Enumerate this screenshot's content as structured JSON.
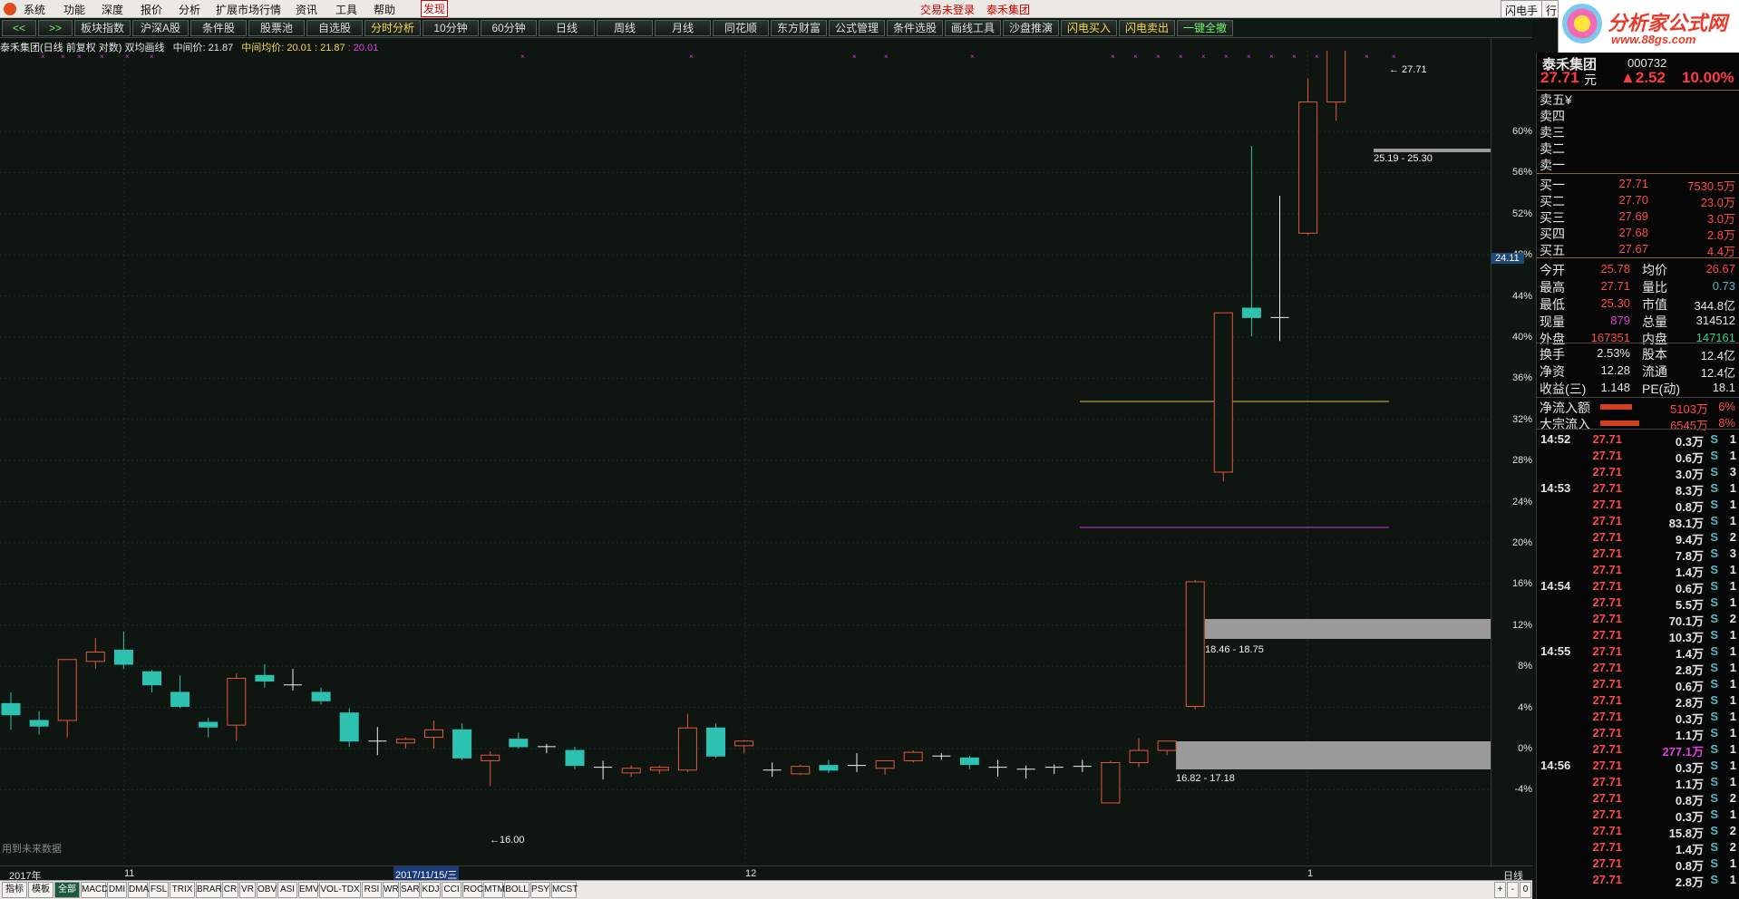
{
  "menubar": {
    "items": [
      "系统",
      "功能",
      "深度",
      "报价",
      "分析",
      "扩展市场行情",
      "资讯",
      "工具",
      "帮助"
    ],
    "discover": "发现",
    "login": "交易未登录",
    "stock_title": "泰禾集团",
    "shandian": "闪电手",
    "hang": "行"
  },
  "toolbar": {
    "prev": "<<",
    "next": ">>",
    "buttons": [
      "板块指数",
      "沪深A股",
      "条件股",
      "股票池",
      "自选股",
      "分时分析",
      "10分钟",
      "60分钟",
      "日线",
      "周线",
      "月线",
      "同花顺",
      "东方财富",
      "公式管理",
      "条件选股",
      "画线工具",
      "沙盘推演",
      "闪电买入",
      "闪电卖出",
      "一键全撤"
    ]
  },
  "brand": {
    "title": "分析家公式网",
    "url": "www.88gs.com"
  },
  "chart_header": {
    "title": "泰禾集团(日线 前复权 对数) 双均画线",
    "mid_label": "中间价: 21.87",
    "avg_label": "中间均价: 20.01 : 21.87",
    "avg_mag": ": 20.01"
  },
  "chart_data": {
    "type": "candlestick",
    "title": "泰禾集团(日线 前复权 对数) 双均画线",
    "candles": [
      {
        "o": 16.88,
        "h": 17.0,
        "c": 16.76,
        "l": 16.6
      },
      {
        "o": 16.7,
        "h": 16.8,
        "c": 16.64,
        "l": 16.55
      },
      {
        "o": 16.7,
        "h": 17.35,
        "c": 17.35,
        "l": 16.52
      },
      {
        "o": 17.33,
        "h": 17.58,
        "c": 17.43,
        "l": 17.25
      },
      {
        "o": 17.45,
        "h": 17.65,
        "c": 17.3,
        "l": 17.25
      },
      {
        "o": 17.22,
        "h": 17.24,
        "c": 17.08,
        "l": 17.0
      },
      {
        "o": 17.0,
        "h": 17.18,
        "c": 16.85,
        "l": 16.83
      },
      {
        "o": 16.68,
        "h": 16.73,
        "c": 16.63,
        "l": 16.52
      },
      {
        "o": 16.65,
        "h": 17.2,
        "c": 17.15,
        "l": 16.48
      },
      {
        "o": 17.18,
        "h": 17.3,
        "c": 17.12,
        "l": 17.05
      },
      {
        "o": 17.08,
        "h": 17.25,
        "c": 17.08,
        "l": 17.02
      },
      {
        "o": 17.0,
        "h": 17.05,
        "c": 16.91,
        "l": 16.87
      },
      {
        "o": 16.78,
        "h": 16.83,
        "c": 16.48,
        "l": 16.42
      },
      {
        "o": 16.48,
        "h": 16.63,
        "c": 16.47,
        "l": 16.33
      },
      {
        "o": 16.46,
        "h": 16.52,
        "c": 16.5,
        "l": 16.4
      },
      {
        "o": 16.52,
        "h": 16.7,
        "c": 16.6,
        "l": 16.4
      },
      {
        "o": 16.6,
        "h": 16.67,
        "c": 16.3,
        "l": 16.28
      },
      {
        "o": 16.27,
        "h": 16.37,
        "c": 16.33,
        "l": 16.0
      },
      {
        "o": 16.5,
        "h": 16.57,
        "c": 16.42,
        "l": 16.4
      },
      {
        "o": 16.42,
        "h": 16.45,
        "c": 16.4,
        "l": 16.35
      },
      {
        "o": 16.38,
        "h": 16.42,
        "c": 16.22,
        "l": 16.18
      },
      {
        "o": 16.2,
        "h": 16.27,
        "c": 16.19,
        "l": 16.07
      },
      {
        "o": 16.14,
        "h": 16.22,
        "c": 16.19,
        "l": 16.1
      },
      {
        "o": 16.17,
        "h": 16.22,
        "c": 16.2,
        "l": 16.13
      },
      {
        "o": 16.17,
        "h": 16.77,
        "c": 16.62,
        "l": 16.15
      },
      {
        "o": 16.62,
        "h": 16.67,
        "c": 16.32,
        "l": 16.3
      },
      {
        "o": 16.43,
        "h": 16.49,
        "c": 16.48,
        "l": 16.35
      },
      {
        "o": 16.16,
        "h": 16.25,
        "c": 16.17,
        "l": 16.1
      },
      {
        "o": 16.13,
        "h": 16.23,
        "c": 16.21,
        "l": 16.12
      },
      {
        "o": 16.22,
        "h": 16.28,
        "c": 16.17,
        "l": 16.14
      },
      {
        "o": 16.2,
        "h": 16.35,
        "c": 16.22,
        "l": 16.15
      },
      {
        "o": 16.19,
        "h": 16.25,
        "c": 16.27,
        "l": 16.12
      },
      {
        "o": 16.27,
        "h": 16.38,
        "c": 16.36,
        "l": 16.25
      },
      {
        "o": 16.32,
        "h": 16.35,
        "c": 16.3,
        "l": 16.28
      },
      {
        "o": 16.3,
        "h": 16.32,
        "c": 16.23,
        "l": 16.18
      },
      {
        "o": 16.2,
        "h": 16.28,
        "c": 16.2,
        "l": 16.1
      },
      {
        "o": 16.17,
        "h": 16.22,
        "c": 16.18,
        "l": 16.08
      },
      {
        "o": 16.2,
        "h": 16.23,
        "c": 16.19,
        "l": 16.13
      },
      {
        "o": 16.19,
        "h": 16.28,
        "c": 16.21,
        "l": 16.15
      },
      {
        "o": 15.82,
        "h": 16.27,
        "c": 16.25,
        "l": 15.82
      },
      {
        "o": 16.25,
        "h": 16.51,
        "c": 16.38,
        "l": 16.2
      },
      {
        "o": 16.38,
        "h": 16.45,
        "c": 16.48,
        "l": 16.33
      },
      {
        "o": 16.85,
        "h": 18.2,
        "c": 18.18,
        "l": 16.82
      },
      {
        "o": 19.35,
        "h": 21.05,
        "c": 21.05,
        "l": 19.25
      },
      {
        "o": 21.1,
        "h": 22.83,
        "c": 21.0,
        "l": 20.8
      },
      {
        "o": 20.98,
        "h": 22.3,
        "c": 21.0,
        "l": 20.75
      },
      {
        "o": 21.9,
        "h": 23.55,
        "c": 23.3,
        "l": 21.88
      },
      {
        "o": 23.3,
        "h": 24.85,
        "c": 24.9,
        "l": 23.1
      },
      {
        "o": 25.35,
        "h": 28.0,
        "c": 28.0,
        "l": 25.3
      },
      {
        "o": 27.71,
        "h": 30.5,
        "c": 30.5,
        "l": 27.71
      }
    ],
    "pct_ticks": [
      "60%",
      "56%",
      "52%",
      "48%",
      "44%",
      "40%",
      "36%",
      "32%",
      "28%",
      "24%",
      "20%",
      "16%",
      "12%",
      "8%",
      "4%",
      "0%",
      "-4%"
    ],
    "price_tag": "24.11",
    "zones": [
      {
        "label": "25.19 - 25.30"
      },
      {
        "label": "18.46 - 18.75"
      },
      {
        "label": "16.82 - 17.18"
      }
    ],
    "marks": {
      "high": "27.71",
      "low": "16.00"
    },
    "future_note": "用到未来数据"
  },
  "dates": {
    "year": "2017年",
    "m11": "11",
    "sel": "2017/11/15/三",
    "m12": "12",
    "m1": "1",
    "period": "日线"
  },
  "bottom_tabs": [
    "指标",
    "模板",
    "全部",
    "MACD",
    "DMI",
    "DMA",
    "FSL",
    "TRIX",
    "BRAR",
    "CR",
    "VR",
    "OBV",
    "ASI",
    "EMV",
    "VOL-TDX",
    "RSI",
    "WR",
    "SAR",
    "KDJ",
    "CCI",
    "ROC",
    "MTM",
    "BOLL",
    "PSY",
    "MCST"
  ],
  "bottom_ctrl": [
    "+",
    "-",
    "0"
  ],
  "panel": {
    "name": "泰禾集团",
    "code": "000732",
    "price": "27.71",
    "unit": "元",
    "change": "▲2.52",
    "pct": "10.00%",
    "sell": [
      {
        "l": "卖五",
        "v": "¥"
      },
      {
        "l": "卖四",
        "v": ""
      },
      {
        "l": "卖三",
        "v": ""
      },
      {
        "l": "卖二",
        "v": ""
      },
      {
        "l": "卖一",
        "v": ""
      }
    ],
    "buy": [
      {
        "l": "买一",
        "p": "27.71",
        "v": "7530.5万"
      },
      {
        "l": "买二",
        "p": "27.70",
        "v": "23.0万"
      },
      {
        "l": "买三",
        "p": "27.69",
        "v": "3.0万"
      },
      {
        "l": "买四",
        "p": "27.68",
        "v": "2.8万"
      },
      {
        "l": "买五",
        "p": "27.67",
        "v": "4.4万"
      }
    ],
    "stats": [
      {
        "l1": "今开",
        "v1": "25.78",
        "c1": "red",
        "l2": "均价",
        "v2": "26.67",
        "c2": "red"
      },
      {
        "l1": "最高",
        "v1": "27.71",
        "c1": "red",
        "l2": "量比",
        "v2": "0.73",
        "c2": "cy"
      },
      {
        "l1": "最低",
        "v1": "25.30",
        "c1": "red",
        "l2": "市值",
        "v2": "344.8亿",
        "c2": "wht"
      },
      {
        "l1": "现量",
        "v1": "879",
        "c1": "mag",
        "l2": "总量",
        "v2": "314512",
        "c2": "wht"
      },
      {
        "l1": "外盘",
        "v1": "167351",
        "c1": "red",
        "l2": "内盘",
        "v2": "147161",
        "c2": "grn"
      }
    ],
    "fund": [
      {
        "l1": "换手",
        "v1": "2.53%",
        "l2": "股本",
        "v2": "12.4亿"
      },
      {
        "l1": "净资",
        "v1": "12.28",
        "l2": "流通",
        "v2": "12.4亿"
      },
      {
        "l1": "收益(三)",
        "v1": "1.148",
        "l2": "PE(动)",
        "v2": "18.1"
      }
    ],
    "flows": [
      {
        "l": "净流入额",
        "v": "5103万",
        "p": "6%",
        "bar": 0.5
      },
      {
        "l": "大宗流入",
        "v": "6545万",
        "p": "8%",
        "bar": 0.62
      }
    ],
    "ticks": [
      {
        "t": "14:52",
        "p": "27.71",
        "v": "0.3万",
        "c": "wht",
        "s": "S",
        "n": "1"
      },
      {
        "t": "",
        "p": "27.71",
        "v": "0.6万",
        "c": "wht",
        "s": "S",
        "n": "1"
      },
      {
        "t": "",
        "p": "27.71",
        "v": "3.0万",
        "c": "wht",
        "s": "S",
        "n": "3"
      },
      {
        "t": "14:53",
        "p": "27.71",
        "v": "8.3万",
        "c": "wht",
        "s": "S",
        "n": "1"
      },
      {
        "t": "",
        "p": "27.71",
        "v": "0.8万",
        "c": "wht",
        "s": "S",
        "n": "1"
      },
      {
        "t": "",
        "p": "27.71",
        "v": "83.1万",
        "c": "wht",
        "s": "S",
        "n": "1"
      },
      {
        "t": "",
        "p": "27.71",
        "v": "9.4万",
        "c": "wht",
        "s": "S",
        "n": "2"
      },
      {
        "t": "",
        "p": "27.71",
        "v": "7.8万",
        "c": "wht",
        "s": "S",
        "n": "3"
      },
      {
        "t": "",
        "p": "27.71",
        "v": "1.4万",
        "c": "wht",
        "s": "S",
        "n": "1"
      },
      {
        "t": "14:54",
        "p": "27.71",
        "v": "0.6万",
        "c": "wht",
        "s": "S",
        "n": "1"
      },
      {
        "t": "",
        "p": "27.71",
        "v": "5.5万",
        "c": "wht",
        "s": "S",
        "n": "1"
      },
      {
        "t": "",
        "p": "27.71",
        "v": "70.1万",
        "c": "wht",
        "s": "S",
        "n": "2"
      },
      {
        "t": "",
        "p": "27.71",
        "v": "10.3万",
        "c": "wht",
        "s": "S",
        "n": "1"
      },
      {
        "t": "14:55",
        "p": "27.71",
        "v": "1.4万",
        "c": "wht",
        "s": "S",
        "n": "1"
      },
      {
        "t": "",
        "p": "27.71",
        "v": "2.8万",
        "c": "wht",
        "s": "S",
        "n": "1"
      },
      {
        "t": "",
        "p": "27.71",
        "v": "0.6万",
        "c": "wht",
        "s": "S",
        "n": "1"
      },
      {
        "t": "",
        "p": "27.71",
        "v": "2.8万",
        "c": "wht",
        "s": "S",
        "n": "1"
      },
      {
        "t": "",
        "p": "27.71",
        "v": "0.3万",
        "c": "wht",
        "s": "S",
        "n": "1"
      },
      {
        "t": "",
        "p": "27.71",
        "v": "1.1万",
        "c": "wht",
        "s": "S",
        "n": "1"
      },
      {
        "t": "",
        "p": "27.71",
        "v": "277.1万",
        "c": "mag",
        "s": "S",
        "n": "1"
      },
      {
        "t": "14:56",
        "p": "27.71",
        "v": "0.3万",
        "c": "wht",
        "s": "S",
        "n": "1"
      },
      {
        "t": "",
        "p": "27.71",
        "v": "1.1万",
        "c": "wht",
        "s": "S",
        "n": "1"
      },
      {
        "t": "",
        "p": "27.71",
        "v": "0.8万",
        "c": "wht",
        "s": "S",
        "n": "2"
      },
      {
        "t": "",
        "p": "27.71",
        "v": "0.3万",
        "c": "wht",
        "s": "S",
        "n": "1"
      },
      {
        "t": "",
        "p": "27.71",
        "v": "15.8万",
        "c": "wht",
        "s": "S",
        "n": "2"
      },
      {
        "t": "",
        "p": "27.71",
        "v": "1.4万",
        "c": "wht",
        "s": "S",
        "n": "2"
      },
      {
        "t": "",
        "p": "27.71",
        "v": "0.8万",
        "c": "wht",
        "s": "S",
        "n": "1"
      },
      {
        "t": "",
        "p": "27.71",
        "v": "2.8万",
        "c": "wht",
        "s": "S",
        "n": "1"
      }
    ]
  }
}
